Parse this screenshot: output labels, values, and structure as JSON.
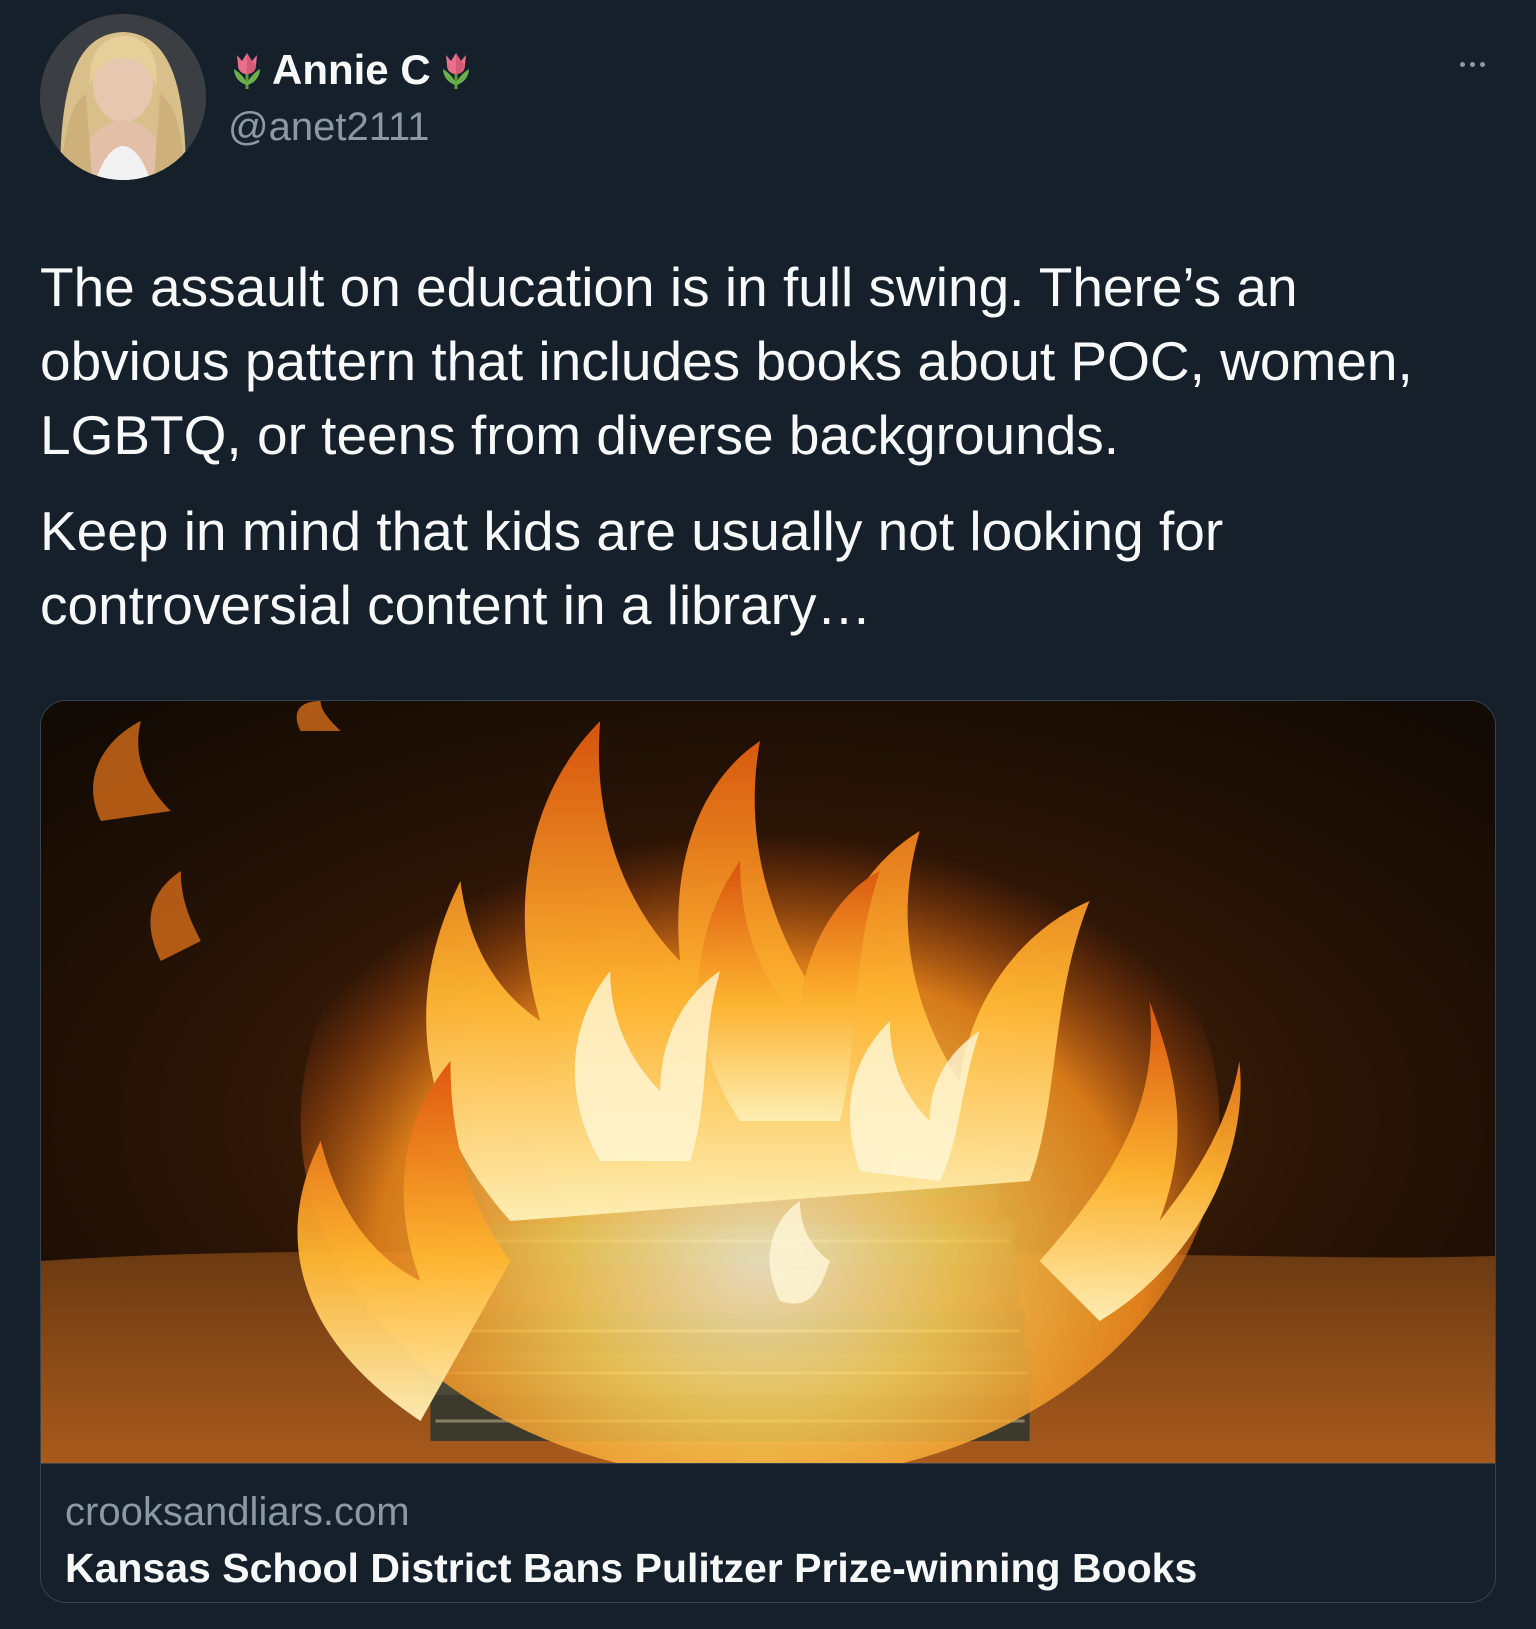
{
  "author": {
    "display_name": "Annie C",
    "handle": "@anet2111",
    "name_emoji": "tulip-icon"
  },
  "tweet": {
    "paragraphs": [
      "The assault on education is in full swing. There’s an obvious pattern that includes books about POC, women, LGBTQ, or teens from diverse backgrounds.",
      "Keep in mind that kids are usually not looking for controversial content in a library…"
    ]
  },
  "card": {
    "image": "burning-books-image",
    "domain": "crooksandliars.com",
    "title": "Kansas School District Bans Pulitzer Prize-winning Books"
  },
  "colors": {
    "background": "#15202b",
    "text_primary": "#f7f9f9",
    "text_secondary": "#8b98a5",
    "border": "#38444d"
  }
}
